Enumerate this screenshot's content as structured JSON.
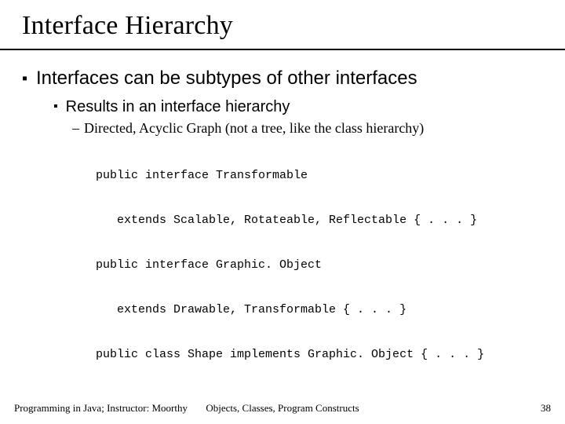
{
  "title": "Interface Hierarchy",
  "bullets": {
    "lvl1": "Interfaces can be subtypes of other interfaces",
    "lvl2": "Results in an interface hierarchy",
    "lvl3": "Directed, Acyclic Graph (not a tree, like the class hierarchy)"
  },
  "code": {
    "l1": "public interface Transformable",
    "l2": "   extends Scalable, Rotateable, Reflectable { . . . }",
    "l3": "public interface Graphic. Object",
    "l4": "   extends Drawable, Transformable { . . . }",
    "l5": "public class Shape implements Graphic. Object { . . . }"
  },
  "footer": {
    "left": "Programming in Java; Instructor: Moorthy",
    "center": "Objects, Classes, Program Constructs",
    "pageno": "38"
  },
  "glyphs": {
    "square": "▪",
    "endash": "–"
  }
}
